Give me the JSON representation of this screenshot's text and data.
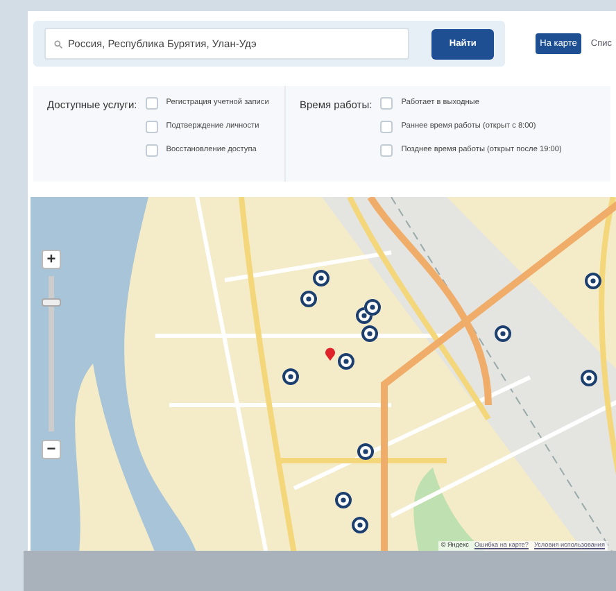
{
  "search": {
    "value": "Россия, Республика Бурятия, Улан-Удэ",
    "button": "Найти"
  },
  "view_tabs": [
    {
      "label": "На карте",
      "selected": true
    },
    {
      "label": "Спис",
      "selected": false
    }
  ],
  "filters": [
    {
      "title": "Доступные услуги:",
      "options": [
        {
          "label": "Регистрация учетной записи",
          "checked": false
        },
        {
          "label": "Подтверждение личности",
          "checked": false
        },
        {
          "label": "Восстановление доступа",
          "checked": false
        }
      ]
    },
    {
      "title": "Время работы:",
      "options": [
        {
          "label": "Работает в выходные",
          "checked": false
        },
        {
          "label": "Раннее время работы (открыт с 8:00)",
          "checked": false
        },
        {
          "label": "Позднее время работы (открыт после 19:00)",
          "checked": false
        }
      ]
    }
  ],
  "map": {
    "zoom_in": "+",
    "zoom_out": "−",
    "level": 0.85,
    "attribution": {
      "copyright": "© Яндекс",
      "links": [
        "Ошибка на карте?",
        "Условия использования"
      ]
    }
  }
}
